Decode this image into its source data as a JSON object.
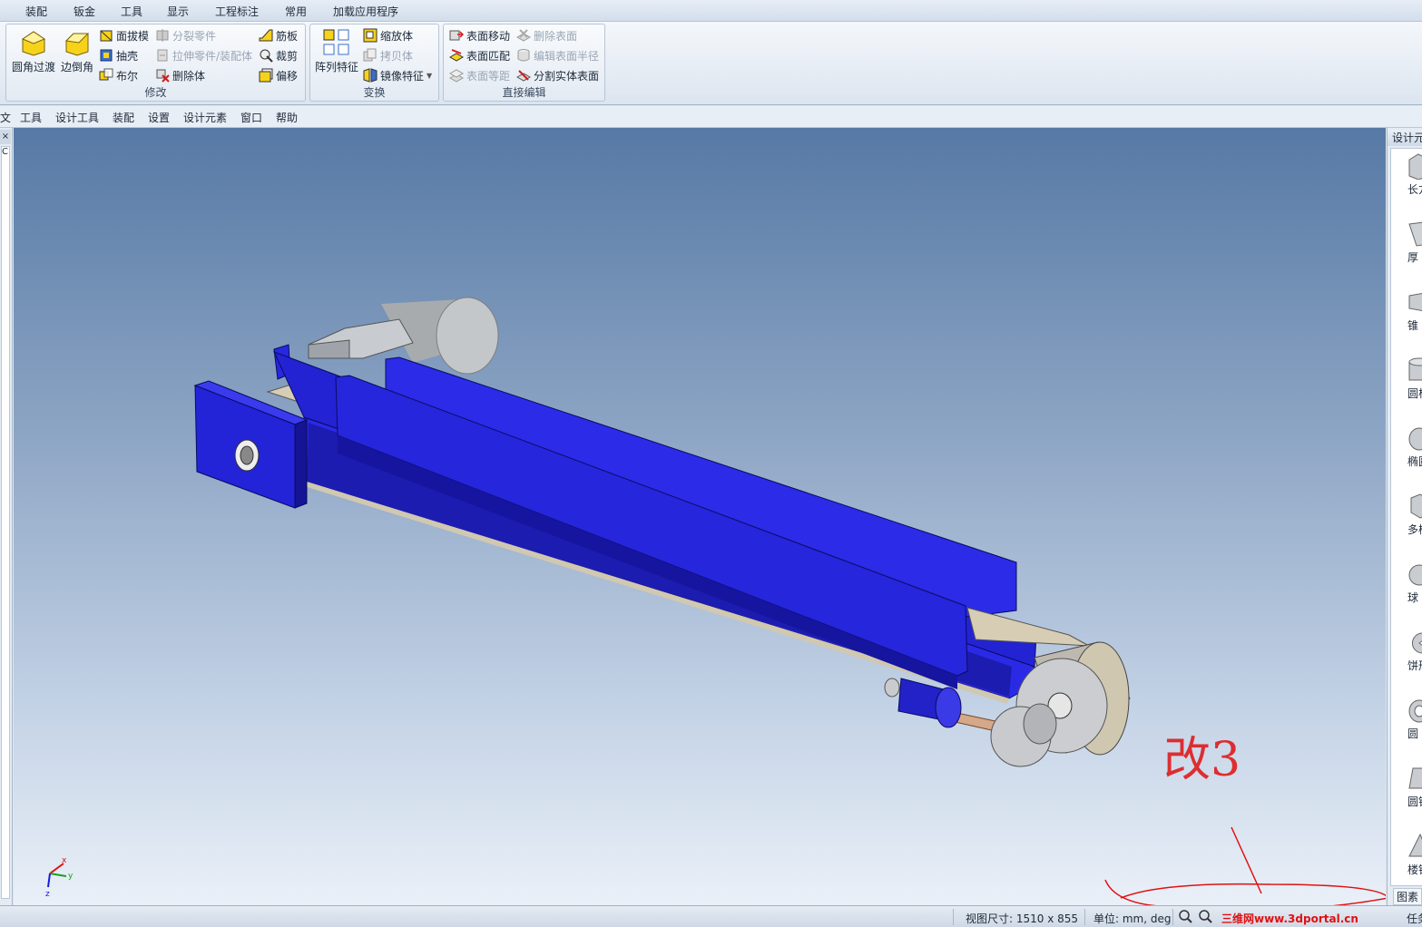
{
  "ribbon_tabs": [
    "装配",
    "钣金",
    "工具",
    "显示",
    "工程标注",
    "常用",
    "加载应用程序"
  ],
  "groups": {
    "modify": {
      "label": "修改",
      "big": [
        {
          "label": "圆角过渡",
          "icon": "fillet-icon"
        },
        {
          "label": "边倒角",
          "icon": "chamfer-icon"
        }
      ],
      "items": [
        {
          "label": "面拔模",
          "icon": "draft-icon",
          "enabled": true
        },
        {
          "label": "抽壳",
          "icon": "shell-icon",
          "enabled": true
        },
        {
          "label": "布尔",
          "icon": "boolean-icon",
          "enabled": true
        },
        {
          "label": "分裂零件",
          "icon": "split-part-icon",
          "enabled": false
        },
        {
          "label": "拉伸零件/装配体",
          "icon": "stretch-icon",
          "enabled": false
        },
        {
          "label": "删除体",
          "icon": "delete-body-icon",
          "enabled": true
        },
        {
          "label": "筋板",
          "icon": "rib-icon",
          "enabled": true
        },
        {
          "label": "裁剪",
          "icon": "trim-icon",
          "enabled": true
        },
        {
          "label": "偏移",
          "icon": "offset-icon",
          "enabled": true
        }
      ]
    },
    "transform": {
      "label": "变换",
      "big": [
        {
          "label": "阵列特征",
          "icon": "pattern-icon"
        }
      ],
      "items": [
        {
          "label": "缩放体",
          "icon": "scale-icon",
          "enabled": true
        },
        {
          "label": "拷贝体",
          "icon": "copy-body-icon",
          "enabled": false
        },
        {
          "label": "镜像特征",
          "icon": "mirror-icon",
          "enabled": true
        }
      ]
    },
    "direct_edit": {
      "label": "直接编辑",
      "items": [
        {
          "label": "表面移动",
          "icon": "face-move-icon",
          "enabled": true
        },
        {
          "label": "表面匹配",
          "icon": "face-match-icon",
          "enabled": true
        },
        {
          "label": "表面等距",
          "icon": "face-offset-icon",
          "enabled": false
        },
        {
          "label": "删除表面",
          "icon": "delete-face-icon",
          "enabled": false
        },
        {
          "label": "编辑表面半径",
          "icon": "edit-radius-icon",
          "enabled": false
        },
        {
          "label": "分割实体表面",
          "icon": "split-face-icon",
          "enabled": true
        }
      ]
    }
  },
  "menu": [
    "文",
    "工具",
    "设计工具",
    "装配",
    "设置",
    "设计元素",
    "窗口",
    "帮助"
  ],
  "left_panel": {
    "tab": "×",
    "content": "C"
  },
  "right_panel": {
    "title": "设计元素",
    "shapes": [
      "长方",
      "厚",
      "锥",
      "圆柱",
      "椭圆",
      "多棱",
      "球",
      "饼形",
      "圆",
      "圆锥",
      "楼锥"
    ],
    "footer": "图素"
  },
  "annotation": {
    "text": "改3",
    "color": "#e01010"
  },
  "axis": {
    "x": "x",
    "y": "y",
    "z": "z"
  },
  "model_colors": {
    "body": "#2323d8",
    "belt": "#d7cdb4",
    "metal": "#b9bdc2"
  },
  "status": {
    "view_size": "视图尺寸: 1510 x  855",
    "units": "单位: mm, deg",
    "watermark": "三维网www.3dportal.cn",
    "tail": "任务"
  }
}
